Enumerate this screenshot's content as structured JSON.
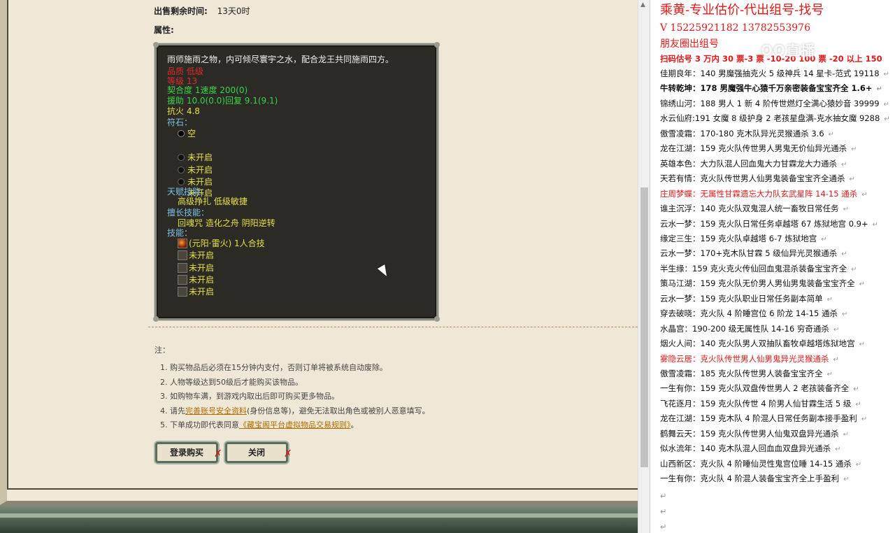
{
  "listing": {
    "remaining_label": "出售剩余时间:",
    "remaining_value": "13天0时",
    "attributes_label": "属性:"
  },
  "item": {
    "desc": "雨师施雨之物，内可倾尽寰宇之水，配合龙王共同施雨四方。",
    "quality": "品质 低级",
    "level": "等级 13",
    "fit": "契合度      1速度      200(0)",
    "assist": "援助      10.0(0.0)回复      9.1(9.1)",
    "fire_res": "抗火 4.8",
    "rune_label": "符石：",
    "runes": [
      "空",
      "未开启",
      "未开启",
      "未开启",
      "未开启"
    ],
    "talent_label": "天赋技能：",
    "talents": "高级挣扎      低级敏捷",
    "expert_label": "擅长技能：",
    "experts": "回魂咒      造化之舟      阴阳逆转",
    "skill_label": "技能：",
    "skills": [
      "(元阳·雷火) 1人合技",
      "未开启",
      "未开启",
      "未开启",
      "未开启"
    ]
  },
  "notes": {
    "title": "注：",
    "items": [
      "1. 购买物品后必须在15分钟内支付，否则订单将被系统自动废除。",
      "2. 人物等级达到50级后才能购买该物品。",
      "3. 如购物车满，到游戏内取出后即可购买更多物品。"
    ],
    "item4_pre": "4. 请先",
    "item4_link": "完善账号安全资料",
    "item4_post": "(身份信息等)，避免无法取出角色或被别人恶意填写。",
    "item5_pre": "5. 下单成功即代表同意",
    "item5_link": "《藏宝阁平台虚拟物品交易规则》",
    "item5_post": "。"
  },
  "buttons": {
    "login_buy": "登录购买",
    "close": "关闭",
    "x": "✗"
  },
  "right": {
    "title": "乘黄-专业估价-代出组号-找号",
    "phone": "V   15225921182   13782553976",
    "friend": "朋友圈出组号",
    "watermark": "OQ直播",
    "scan_line": "扫码估号 3 万内 30 票-3   票 -10-20 100 票 -20 以上 150",
    "lines": [
      {
        "text": "佳期良年：140 男魔强抽克火 5 级神兵 14 星卡-范式 19118",
        "style": ""
      },
      {
        "text": "牛转乾坤：178 男魔强牛心猿千万亲密装备宝宝齐全 1.6+",
        "style": "bold"
      },
      {
        "text": "锦绣山河：188 男人 1 新 4 阶传世燃灯全满心猿妙音 39999",
        "style": ""
      },
      {
        "text": "水云仙府:191 女魔 8 级护身 2 老孩星盘满-克水抽女魔 9288",
        "style": ""
      },
      {
        "text": "傲雪凌霜：170-180 克木队异光灵猴通杀 3.6",
        "style": ""
      },
      {
        "text": "龙在江湖：159 克火队传世男人男鬼无价仙异光通杀",
        "style": ""
      },
      {
        "text": "英雄本色：大力队混人回血鬼大力甘霖龙大力通杀",
        "style": ""
      },
      {
        "text": "天若有情：克火队传世男人仙男鬼装备宝宝齐全通杀",
        "style": ""
      },
      {
        "text": "庄周梦蝶：无属性甘霖遗忘大力队玄武星阵 14-15 通杀",
        "style": "red"
      },
      {
        "text": "谁主沉浮：140 克火队双鬼混人统一畜牧日常任务",
        "style": ""
      },
      {
        "text": "云水一梦：159 克火队日常任务卓越塔 67 炼狱地宫 0.9+",
        "style": ""
      },
      {
        "text": "缘定三生：159 克火队卓越塔 6-7 炼狱地宫",
        "style": ""
      },
      {
        "text": "云水一梦：170+克木队甘霖 5 级仙异光灵猴通杀",
        "style": ""
      },
      {
        "text": "半生缘：159 克火克火传仙回血鬼混杀装备宝宝齐全",
        "style": ""
      },
      {
        "text": "策马江湖：159 克火队无价男人男仙男鬼装备宝宝齐全",
        "style": ""
      },
      {
        "text": "云水一梦：159 克火队职业日常任务副本简单",
        "style": ""
      },
      {
        "text": "穿去破晓：克火队 4 阶睡宫位 6 阶龙 14-15 通杀",
        "style": ""
      },
      {
        "text": "水晶宫：190-200 级无属性队 14-16 穷奇通杀",
        "style": ""
      },
      {
        "text": "烟火人间：140 克火队男人双抽队畜牧卓越塔炼狱地宫",
        "style": ""
      },
      {
        "text": "雾隐云居：克火队传世男人仙男鬼异光灵猴通杀",
        "style": "red"
      },
      {
        "text": "傲雪凌霜：185 克火队传世男人装备宝宝齐全",
        "style": ""
      },
      {
        "text": "一生有你：159 克火队双盘传世男人 2 老孩装备齐全",
        "style": ""
      },
      {
        "text": "飞花逐月：159 克火队传世 4 阶男人仙甘霖生活 5 级",
        "style": ""
      },
      {
        "text": "龙在江湖：159 克木队 4 阶混人日常任务副本接手盈利",
        "style": ""
      },
      {
        "text": "鹤舞云天：159 克火队传世男人仙鬼双盘异光通杀",
        "style": ""
      },
      {
        "text": "似水流年：140 克木队混人回血血双盘异光通杀",
        "style": ""
      },
      {
        "text": "山西新区：克火队 4 阶睡仙灵性鬼宫位睡 14-15 通杀",
        "style": ""
      },
      {
        "text": "一生有你：克火队 4 阶混人装备宝宝齐全上手盈利",
        "style": ""
      }
    ],
    "return_mark": "↵"
  }
}
